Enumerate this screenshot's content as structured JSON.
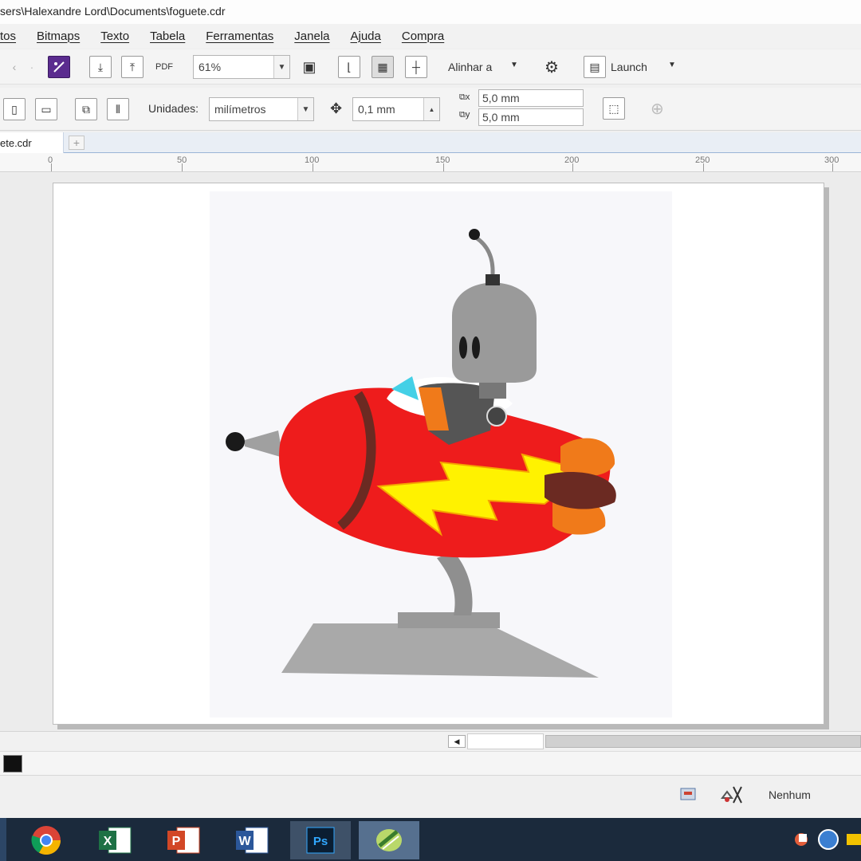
{
  "window": {
    "title": "sers\\Halexandre Lord\\Documents\\foguete.cdr"
  },
  "menu": [
    "tos",
    "Bitmaps",
    "Texto",
    "Tabela",
    "Ferramentas",
    "Janela",
    "Ajuda",
    "Compra"
  ],
  "toolbar": {
    "zoom_value": "61%",
    "align_label": "Alinhar a",
    "launch_label": "Launch"
  },
  "property_bar": {
    "units_label": "Unidades:",
    "units_value": "milímetros",
    "nudge_value": "0,1 mm",
    "dup_x_value": "5,0 mm",
    "dup_y_value": "5,0 mm"
  },
  "document_tab": {
    "label": "ete.cdr"
  },
  "ruler": {
    "labels": [
      "0",
      "50",
      "100",
      "150",
      "200",
      "250",
      "300"
    ]
  },
  "status": {
    "fill_label": "Nenhum"
  },
  "taskbar": {
    "apps": [
      "chrome-icon",
      "excel-icon",
      "powerpoint-icon",
      "word-icon",
      "photoshop-icon",
      "coreldraw-icon"
    ]
  },
  "colors": {
    "rocket_red": "#ee1c1c",
    "flame_yellow": "#fff200",
    "robot_gray": "#9a9a9a",
    "taskbar": "#1b2a3c"
  }
}
